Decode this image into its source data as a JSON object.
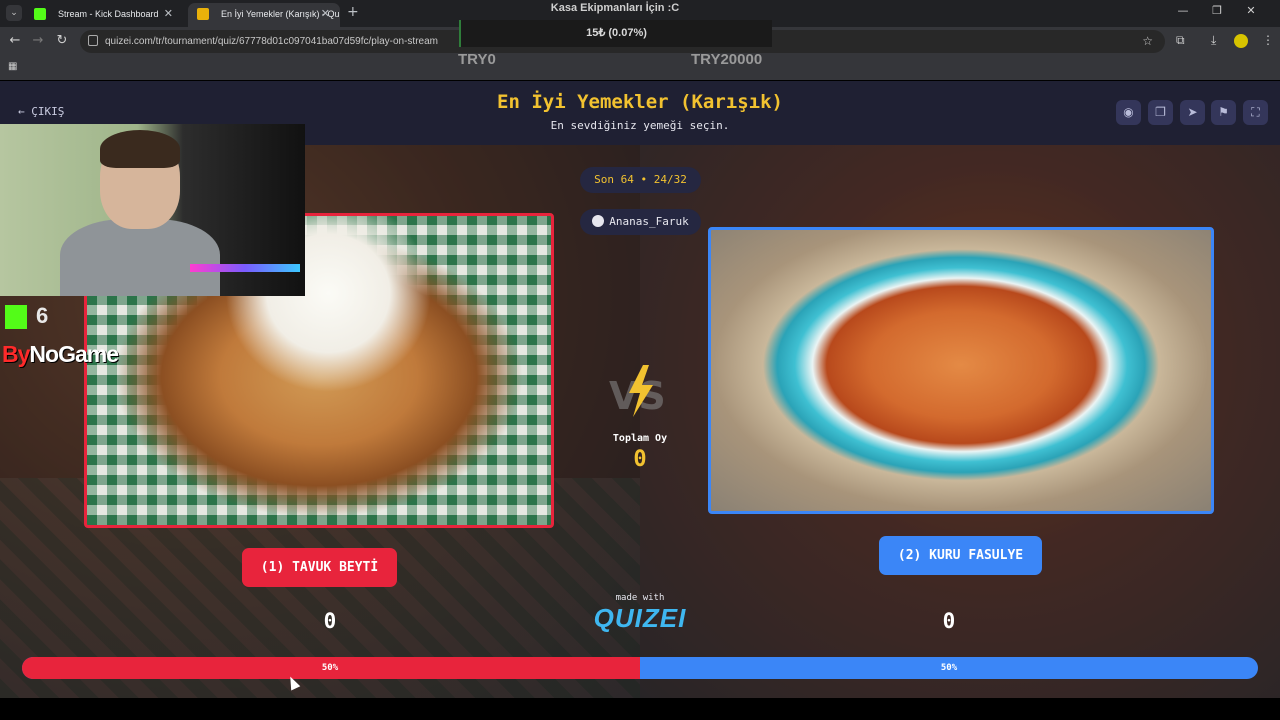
{
  "browser": {
    "tabs": [
      {
        "title": "Stream - Kick Dashboard"
      },
      {
        "title": "En İyi Yemekler (Karışık) - Quizei"
      }
    ],
    "url": "quizei.com/tr/tournament/quiz/67778d01c097041ba07d59fc/play-on-stream"
  },
  "overlay": {
    "goal_title": "Kasa Ekipmanları İçin :C",
    "goal_progress": "15₺ (0.07%)",
    "goal_min": "TRY0",
    "goal_max": "TRY20000",
    "kick_followers": "6",
    "sponsor_prefix": "By",
    "sponsor_rest": "NoGame"
  },
  "header": {
    "exit_label": "← ÇIKIŞ",
    "title": "En İyi Yemekler (Karışık)",
    "subtitle": "En sevdiğiniz yemeği seçin."
  },
  "round": {
    "stage": "Son 64 • 24/32",
    "username": "Ananas_Faruk"
  },
  "matchup": {
    "left": {
      "label": "(1) TAVUK BEYTİ",
      "votes": "0",
      "percent_label": "50%",
      "share": 0.5,
      "color": "#e8243c"
    },
    "right": {
      "label": "(2) KURU FASULYE",
      "votes": "0",
      "percent_label": "50%",
      "share": 0.5,
      "color": "#3b86f7"
    },
    "vs_label": "VS",
    "total_label": "Toplam Oy",
    "total_value": "0"
  },
  "footer": {
    "made_with": "made with",
    "brand": "QUIZEI"
  },
  "colors": {
    "accent_yellow": "#f2c230",
    "header_bg": "#1f2033",
    "left_red": "#e8243c",
    "right_blue": "#3b86f7"
  }
}
